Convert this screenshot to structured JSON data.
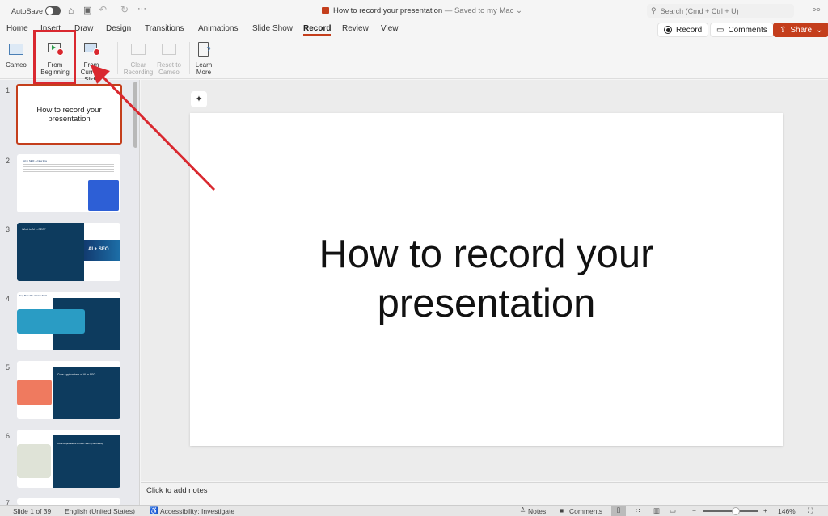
{
  "titlebar": {
    "autosave": "AutoSave",
    "doc_title": "How to record your presentation",
    "saved": "— Saved to my Mac",
    "search_placeholder": "Search (Cmd + Ctrl + U)"
  },
  "tabs": [
    "Home",
    "Insert",
    "Draw",
    "Design",
    "Transitions",
    "Animations",
    "Slide Show",
    "Record",
    "Review",
    "View"
  ],
  "active_tab": "Record",
  "actions": {
    "record": "Record",
    "comments": "Comments",
    "share": "Share"
  },
  "ribbon": {
    "cameo": "Cameo",
    "from_beginning_1": "From",
    "from_beginning_2": "Beginning",
    "from_current_1": "From",
    "from_current_2": "Current Slide",
    "clear_1": "Clear",
    "clear_2": "Recording",
    "reset_1": "Reset to",
    "reset_2": "Cameo",
    "learn_1": "Learn",
    "learn_2": "More"
  },
  "slides": [
    {
      "num": "1",
      "title": "How to record your presentation"
    },
    {
      "num": "2",
      "title": "AI in SEO: A New Era"
    },
    {
      "num": "3",
      "title": "What is AI in SEO?"
    },
    {
      "num": "4",
      "title": "Key Benefits of AI in SEO"
    },
    {
      "num": "5",
      "title": "Core Applications of AI in SEO"
    },
    {
      "num": "6",
      "title": "Core Applications of AI in SEO (continued)"
    },
    {
      "num": "7",
      "title": ""
    }
  ],
  "slide_canvas": {
    "title": "How to record your presentation"
  },
  "notes": {
    "placeholder": "Click to add notes"
  },
  "status": {
    "slide": "Slide 1 of 39",
    "language": "English (United States)",
    "accessibility": "Accessibility: Investigate",
    "notes": "Notes",
    "comments": "Comments",
    "zoom": "146%"
  },
  "colors": {
    "accent": "#c43e1c",
    "annotation": "#d9282f",
    "slide_dark": "#0d3b5e"
  }
}
